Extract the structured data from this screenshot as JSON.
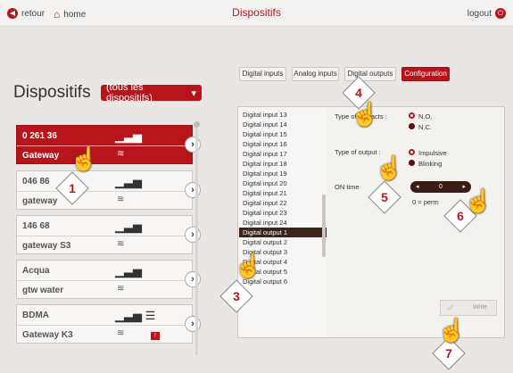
{
  "topbar": {
    "back_label": "retour",
    "home_label": "home",
    "title": "Dispositifs",
    "logout_label": "logout"
  },
  "left": {
    "title": "Dispositifs",
    "filter_value": "(tous les dispositifs)",
    "devices": [
      {
        "id": "0 261 36",
        "name": "Gateway",
        "selected": true
      },
      {
        "id": "046 86",
        "name": "gateway",
        "selected": false
      },
      {
        "id": "146 68",
        "name": "gateway S3",
        "selected": false
      },
      {
        "id": "Acqua",
        "name": "gtw water",
        "selected": false
      },
      {
        "id": "BDMA",
        "name": "Gateway K3",
        "selected": false
      }
    ],
    "alert_badge": "!"
  },
  "tabs": [
    "Digital inputs",
    "Analog inputs",
    "Digital outputs",
    "Configuration"
  ],
  "active_tab": "Configuration",
  "config": {
    "list_items": [
      "Digital input 13",
      "Digital input 14",
      "Digital input 15",
      "Digital input 16",
      "Digital input 17",
      "Digital input 18",
      "Digital input 19",
      "Digital input 20",
      "Digital input 21",
      "Digital input 22",
      "Digital input 23",
      "Digital input 24",
      "Digital output 1",
      "Digital output 2",
      "Digital output 3",
      "Digital output 4",
      "Digital output 5",
      "Digital output 6"
    ],
    "selected_item": "Digital output 1",
    "type_of_contacts_label": "Type of contacts :",
    "contacts_options": [
      "N.O.",
      "N.C."
    ],
    "contacts_selected": "N.O.",
    "type_of_output_label": "Type of output :",
    "output_options": [
      "Impulsive",
      "Blinking"
    ],
    "output_selected": "Impulsive",
    "on_time_label": "ON time",
    "on_time_value": "0",
    "permanent_note": "0 = perm",
    "write_label": "Write"
  },
  "callouts": [
    "1",
    "2",
    "3",
    "4",
    "5",
    "6",
    "7"
  ],
  "colors": {
    "accent": "#b8141b",
    "dark": "#3d2418"
  }
}
